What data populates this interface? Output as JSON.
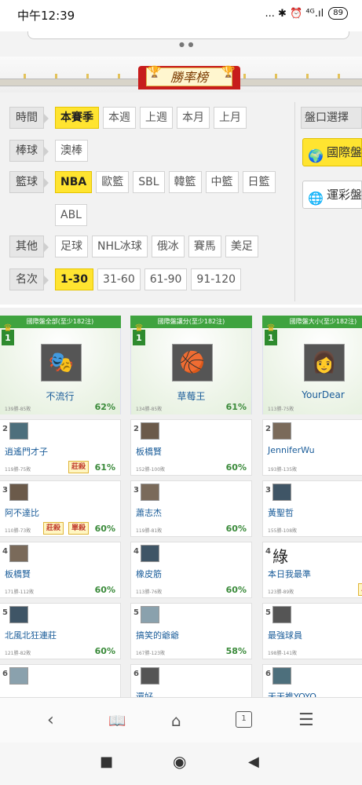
{
  "status": {
    "time": "中午12:39",
    "icons": "... ✱ ⏰ ⁴ᴳ.ıl",
    "battery": "89"
  },
  "page_title": "勝率榜",
  "filters": {
    "rows": [
      {
        "label": "時間",
        "options": [
          "本賽季",
          "本週",
          "上週",
          "本月",
          "上月"
        ],
        "active": 0
      },
      {
        "label": "棒球",
        "options": [
          "澳棒"
        ],
        "active": -1
      },
      {
        "label": "籃球",
        "options": [
          "NBA",
          "歐籃",
          "SBL",
          "韓籃",
          "中籃",
          "日籃"
        ],
        "active": 0
      },
      {
        "label": "",
        "options": [
          "ABL"
        ],
        "active": -1
      },
      {
        "label": "其他",
        "options": [
          "足球",
          "NHL冰球",
          "俄冰",
          "賽馬",
          "美足"
        ],
        "active": -1
      },
      {
        "label": "名次",
        "options": [
          "1-30",
          "31-60",
          "61-90",
          "91-120"
        ],
        "active": 0
      }
    ],
    "side_label": "盤口選擇",
    "side_options": [
      "國際盤",
      "運彩盤"
    ]
  },
  "ranking": {
    "columns": [
      {
        "header": "國際盤全部(至少182注)",
        "top": {
          "rank": "1",
          "name": "不流行",
          "record": "139勝-85敗",
          "pct": "62%"
        },
        "entries": [
          {
            "rank": "2",
            "name": "逍遙門才子",
            "record": "119勝-75敗",
            "tags": [
              "莊殺"
            ],
            "pct": "61%"
          },
          {
            "rank": "3",
            "name": "阿不達比",
            "record": "110勝-73敗",
            "tags": [
              "莊殺",
              "單殺"
            ],
            "pct": "60%"
          },
          {
            "rank": "4",
            "name": "板橋賢",
            "record": "171勝-112敗",
            "tags": [],
            "pct": "60%"
          },
          {
            "rank": "5",
            "name": "北風北狂連莊",
            "record": "121勝-82敗",
            "tags": [],
            "pct": "60%"
          },
          {
            "rank": "6",
            "name": "",
            "record": "",
            "tags": [],
            "pct": ""
          }
        ]
      },
      {
        "header": "國際盤讓分(至少182注)",
        "top": {
          "rank": "1",
          "name": "草莓王",
          "record": "134勝-85敗",
          "pct": "61%"
        },
        "entries": [
          {
            "rank": "2",
            "name": "板橋賢",
            "record": "152勝-100敗",
            "tags": [],
            "pct": "60%"
          },
          {
            "rank": "3",
            "name": "蕭志杰",
            "record": "119勝-81敗",
            "tags": [],
            "pct": "60%"
          },
          {
            "rank": "4",
            "name": "橡皮筋",
            "record": "113勝-76敗",
            "tags": [],
            "pct": "60%"
          },
          {
            "rank": "5",
            "name": "搞笑的爺爺",
            "record": "167勝-123敗",
            "tags": [],
            "pct": "58%"
          },
          {
            "rank": "6",
            "name": "還好",
            "record": "",
            "tags": [],
            "pct": ""
          }
        ]
      },
      {
        "header": "國際盤大小(至少182注)",
        "top": {
          "rank": "1",
          "name": "YourDear",
          "record": "113勝-75敗",
          "pct": ""
        },
        "entries": [
          {
            "rank": "2",
            "name": "JenniferWu",
            "record": "193勝-135敗",
            "tags": [],
            "pct": ""
          },
          {
            "rank": "3",
            "name": "黃聖哲",
            "record": "155勝-108敗",
            "tags": [],
            "pct": ""
          },
          {
            "rank": "4",
            "name": "本日我最準",
            "record": "123勝-89敗",
            "tags": [
              "單殺"
            ],
            "pct": "",
            "big_char": "綠"
          },
          {
            "rank": "5",
            "name": "最強球員",
            "record": "198勝-141敗",
            "tags": [],
            "pct": ""
          },
          {
            "rank": "6",
            "name": "天天推YOYO",
            "record": "",
            "tags": [],
            "pct": ""
          }
        ]
      }
    ]
  },
  "browser": {
    "tab_count": "1"
  },
  "colors": {
    "accent_yellow": "#ffe430",
    "header_green": "#3fa33f",
    "pct_green": "#3a8a3a",
    "link_blue": "#1a5c99"
  }
}
